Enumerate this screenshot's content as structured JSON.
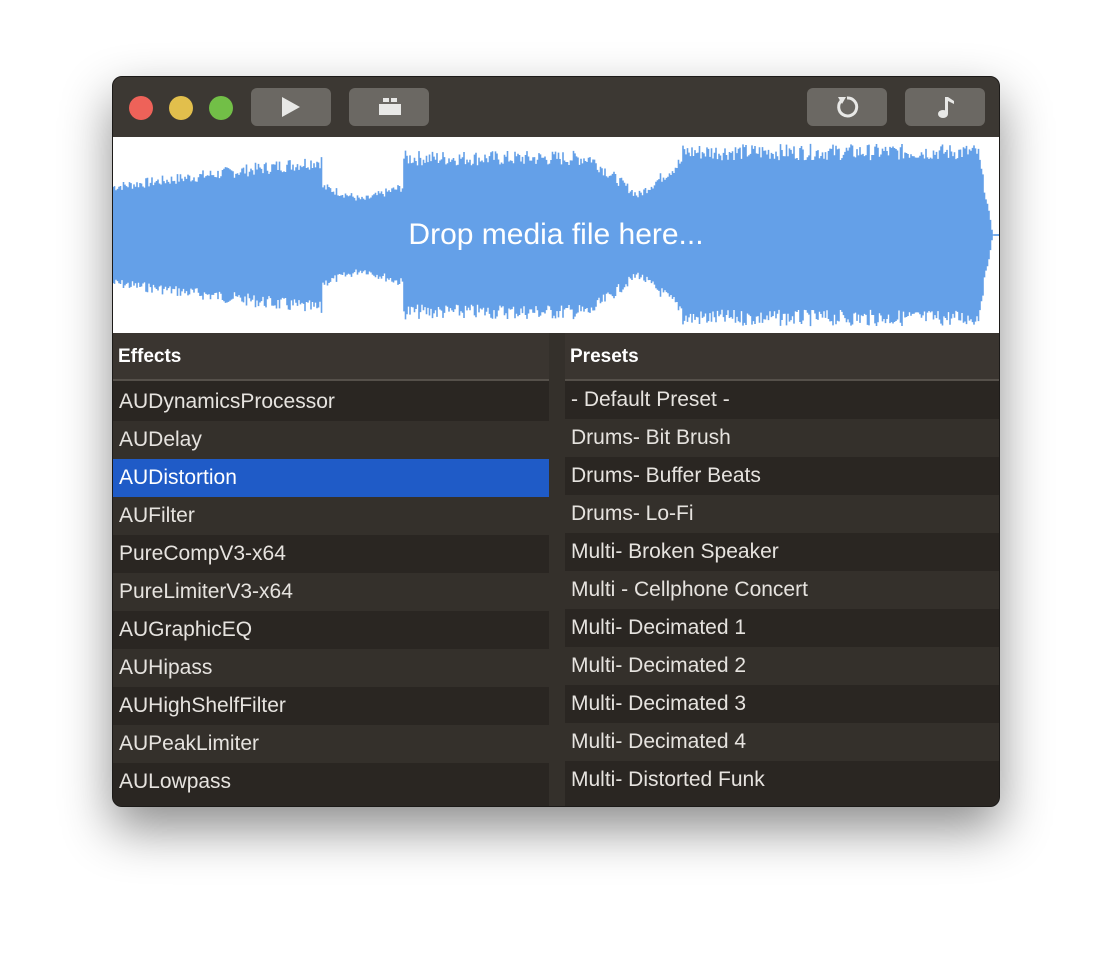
{
  "toolbar": {
    "play": "play-icon",
    "stage": "stage-icon",
    "reset": "reset-icon",
    "music": "music-note-icon"
  },
  "waveform": {
    "placeholder": "Drop media file here...",
    "color": "#64a0e8"
  },
  "effects": {
    "header": "Effects",
    "selected_index": 2,
    "items": [
      "AUDynamicsProcessor",
      "AUDelay",
      "AUDistortion",
      "AUFilter",
      "PureCompV3-x64",
      "PureLimiterV3-x64",
      "AUGraphicEQ",
      "AUHipass",
      "AUHighShelfFilter",
      "AUPeakLimiter",
      "AULowpass"
    ]
  },
  "presets": {
    "header": "Presets",
    "items": [
      "- Default Preset -",
      "Drums- Bit Brush",
      "Drums- Buffer Beats",
      "Drums- Lo-Fi",
      "Multi- Broken Speaker",
      "Multi - Cellphone Concert",
      "Multi- Decimated 1",
      "Multi- Decimated 2",
      "Multi- Decimated 3",
      "Multi- Decimated 4",
      "Multi- Distorted Funk"
    ]
  }
}
